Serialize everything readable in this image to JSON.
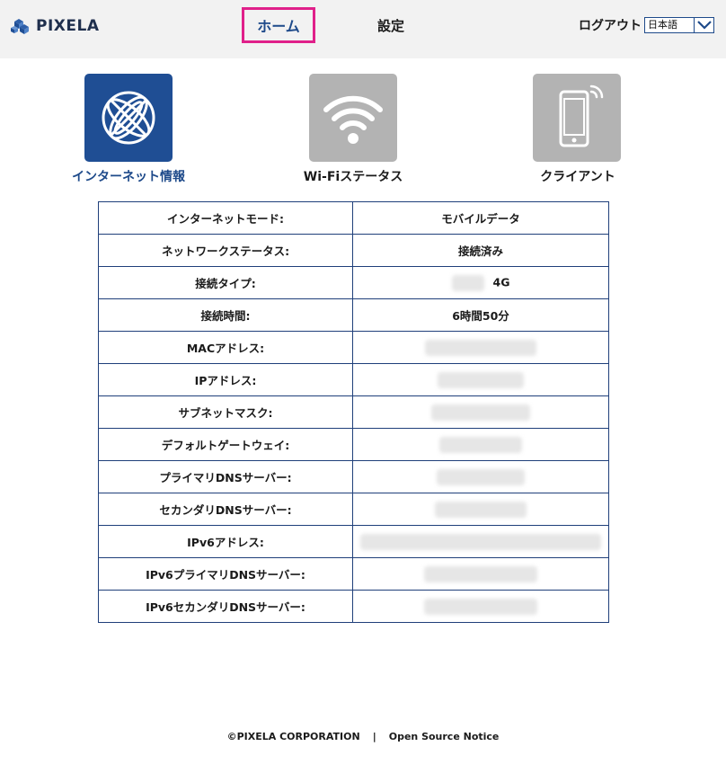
{
  "header": {
    "logo_text": "PIXELA",
    "nav_home": "ホーム",
    "nav_settings": "設定",
    "logout": "ログアウト",
    "language": "日本語"
  },
  "tiles": [
    {
      "label": "インターネット情報",
      "icon": "globe-icon",
      "active": true
    },
    {
      "label": "Wi-Fiステータス",
      "icon": "wifi-icon",
      "active": false
    },
    {
      "label": "クライアント",
      "icon": "smartphone-icon",
      "active": false
    }
  ],
  "table": {
    "rows": [
      {
        "key": "インターネットモード:",
        "value": "モバイルデータ"
      },
      {
        "key": "ネットワークステータス:",
        "value": "接続済み"
      },
      {
        "key": "接続タイプ:",
        "value": "4G"
      },
      {
        "key": "接続時間:",
        "value": "6時間50分"
      },
      {
        "key": "MACアドレス:",
        "value": ""
      },
      {
        "key": "IPアドレス:",
        "value": ""
      },
      {
        "key": "サブネットマスク:",
        "value": ""
      },
      {
        "key": "デフォルトゲートウェイ:",
        "value": ""
      },
      {
        "key": "プライマリDNSサーバー:",
        "value": ""
      },
      {
        "key": "セカンダリDNSサーバー:",
        "value": ""
      },
      {
        "key": "IPv6アドレス:",
        "value": ""
      },
      {
        "key": "IPv6プライマリDNSサーバー:",
        "value": ""
      },
      {
        "key": "IPv6セカンダリDNSサーバー:",
        "value": ""
      }
    ]
  },
  "footer": {
    "copyright": "©PIXELA CORPORATION",
    "separator": "|",
    "oss": "Open Source Notice"
  },
  "colors": {
    "accent": "#1f4e94",
    "highlight_border": "#e0208a",
    "tile_inactive": "#b3b3b3"
  }
}
